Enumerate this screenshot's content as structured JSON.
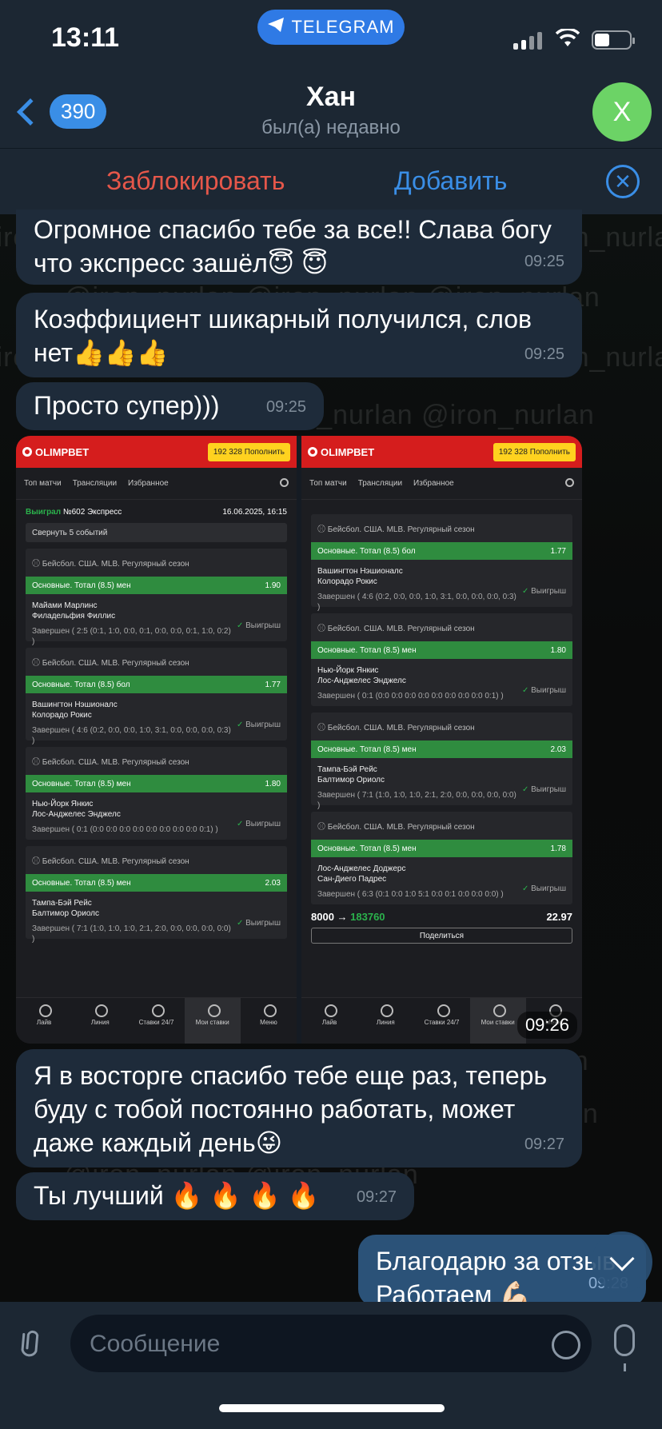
{
  "status": {
    "time": "13:11",
    "pill_label": "TELEGRAM"
  },
  "header": {
    "back_count": "390",
    "name": "Хан",
    "last_seen": "был(а) недавно",
    "avatar_letter": "Х",
    "avatar_color": "#6cd366"
  },
  "actions": {
    "block": "Заблокировать",
    "add": "Добавить"
  },
  "watermark": "@iron_nurlan",
  "messages": [
    {
      "text": "Огромное спасибо тебе за все!! Слава богу что экспресс зашёл😇 😇",
      "time": "09:25"
    },
    {
      "text": "Коэффициент шикарный получился, слов нет👍👍👍",
      "time": "09:25"
    },
    {
      "text": "Просто супер)))",
      "time": "09:25"
    },
    {
      "text": "Я в восторге спасибо тебе еще раз, теперь буду с тобой постоянно работать, может даже каждый день😜",
      "time": "09:27"
    },
    {
      "text": "Ты лучший 🔥 🔥 🔥 🔥",
      "time": "09:27"
    },
    {
      "text": "Благодарю за отзыв Работаем 💪🏻",
      "time": "09:28"
    }
  ],
  "photo": {
    "time": "09:26",
    "brand": "OLIMPBET",
    "balance": "192 328 Пополнить",
    "nav": [
      "Топ матчи",
      "Трансляции",
      "Избранное"
    ],
    "win_label": "Выиграл",
    "bet_title": "№602 Экспресс",
    "bet_date": "16.06.2025, 16:15",
    "collapse": "Свернуть 5 событий",
    "league": "Бейсбол. США. MLB. Регулярный сезон",
    "won": "Выигрыш",
    "left_events": [
      {
        "market": "Основные. Тотал (8.5) мен",
        "odd": "1.90",
        "team1": "Майами Марлинс",
        "team2": "Филадельфия Филлис",
        "result": "Завершен ( 2:5 (0:1, 1:0, 0:0, 0:1, 0:0, 0:0, 0:1, 1:0, 0:2) )"
      },
      {
        "market": "Основные. Тотал (8.5) бол",
        "odd": "1.77",
        "team1": "Вашингтон Нэшионалс",
        "team2": "Колорадо Рокис",
        "result": "Завершен ( 4:6 (0:2, 0:0, 0:0, 1:0, 3:1, 0:0, 0:0, 0:0, 0:3) )"
      },
      {
        "market": "Основные. Тотал (8.5) мен",
        "odd": "1.80",
        "team1": "Нью-Йорк Янкис",
        "team2": "Лос-Анджелес Энджелс",
        "result": "Завершен ( 0:1 (0:0 0:0 0:0 0:0 0:0 0:0 0:0 0:0 0:1) )"
      },
      {
        "market": "Основные. Тотал (8.5) мен",
        "odd": "2.03",
        "team1": "Тампа-Бэй Рейс",
        "team2": "Балтимор Ориолс",
        "result": "Завершен ( 7:1 (1:0, 1:0, 1:0, 2:1, 2:0, 0:0, 0:0, 0:0, 0:0) )"
      }
    ],
    "right_events": [
      {
        "market": "Основные. Тотал (8.5) бол",
        "odd": "1.77",
        "team1": "Вашингтон Нэшионалс",
        "team2": "Колорадо Рокис",
        "result": "Завершен ( 4:6 (0:2, 0:0, 0:0, 1:0, 3:1, 0:0, 0:0, 0:0, 0:3) )"
      },
      {
        "market": "Основные. Тотал (8.5) мен",
        "odd": "1.80",
        "team1": "Нью-Йорк Янкис",
        "team2": "Лос-Анджелес Энджелс",
        "result": "Завершен ( 0:1 (0:0 0:0 0:0 0:0 0:0 0:0 0:0 0:0 0:1) )"
      },
      {
        "market": "Основные. Тотал (8.5) мен",
        "odd": "2.03",
        "team1": "Тампа-Бэй Рейс",
        "team2": "Балтимор Ориолс",
        "result": "Завершен ( 7:1 (1:0, 1:0, 1:0, 2:1, 2:0, 0:0, 0:0, 0:0, 0:0) )"
      },
      {
        "market": "Основные. Тотал (8.5) мен",
        "odd": "1.78",
        "team1": "Лос-Анджелес Доджерс",
        "team2": "Сан-Диего Падрес",
        "result": "Завершен ( 6:3 (0:1 0:0 1:0 5:1 0:0 0:1 0:0 0:0 0:0) )"
      }
    ],
    "stake": "8000",
    "payout": "183760",
    "coef": "22.97",
    "share": "Поделиться",
    "bottom_nav": [
      "Лайв",
      "Линия",
      "Ставки 24/7",
      "Мои ставки",
      "Меню"
    ]
  },
  "input": {
    "placeholder": "Сообщение"
  }
}
